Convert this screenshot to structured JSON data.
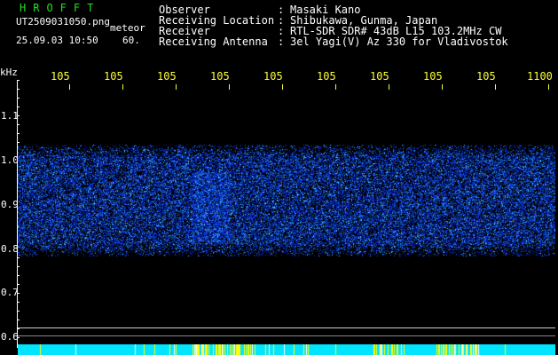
{
  "header": {
    "brand": "HROFFT",
    "filename": "UT2509031050.png",
    "meteor_label": "meteor",
    "datetime": "25.09.03 10:50",
    "duration": "60.",
    "fields": [
      {
        "label": "Observer",
        "sep": ":",
        "value": "Masaki Kano"
      },
      {
        "label": "Receiving Location",
        "sep": ":",
        "value": "Shibukawa, Gunma, Japan"
      },
      {
        "label": "Receiver",
        "sep": ":",
        "value": "RTL-SDR SDR# 43dB L15 103.2MHz CW"
      },
      {
        "label": "Receiving Antenna",
        "sep": ":",
        "value": "3el Yagi(V) Az 330 for Vladivostok"
      }
    ]
  },
  "time_axis": {
    "ticks": [
      "105",
      "105",
      "105",
      "105",
      "105",
      "105",
      "105",
      "105",
      "105",
      "1100"
    ]
  },
  "freq_axis": {
    "unit": "kHz",
    "ticks": [
      "1.1",
      "1.0",
      "0.9",
      "0.8",
      "0.7",
      "0.6"
    ]
  },
  "colors": {
    "background": "#000000",
    "header_text": "#ffffff",
    "brand": "#22dd22",
    "time_ticks": "#ffff33",
    "signal": "#2244ff",
    "bottom_bar": "#00e5ff",
    "bottom_marks": "#ffff00"
  }
}
